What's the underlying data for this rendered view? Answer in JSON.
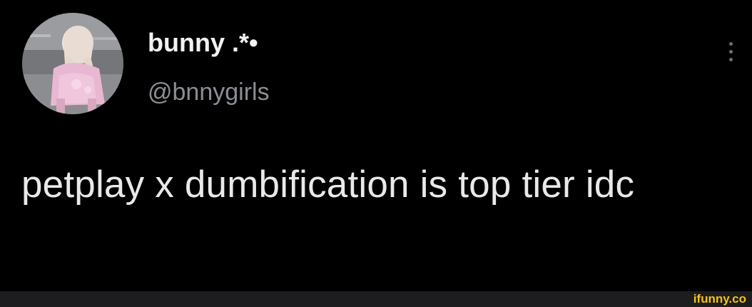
{
  "tweet": {
    "display_name": "bunny .*•",
    "handle": "@bnnygirls",
    "text": "petplay x dumbification is top tier idc",
    "more_icon": "vertical-ellipsis-icon",
    "avatar_icon": "profile-photo"
  },
  "footer": {
    "brand": "ifunny.co"
  },
  "colors": {
    "background": "#000000",
    "text": "#e9e9e9",
    "handle": "#8b8f94",
    "brand": "#f2c21b",
    "footer": "#1d1d1f"
  }
}
